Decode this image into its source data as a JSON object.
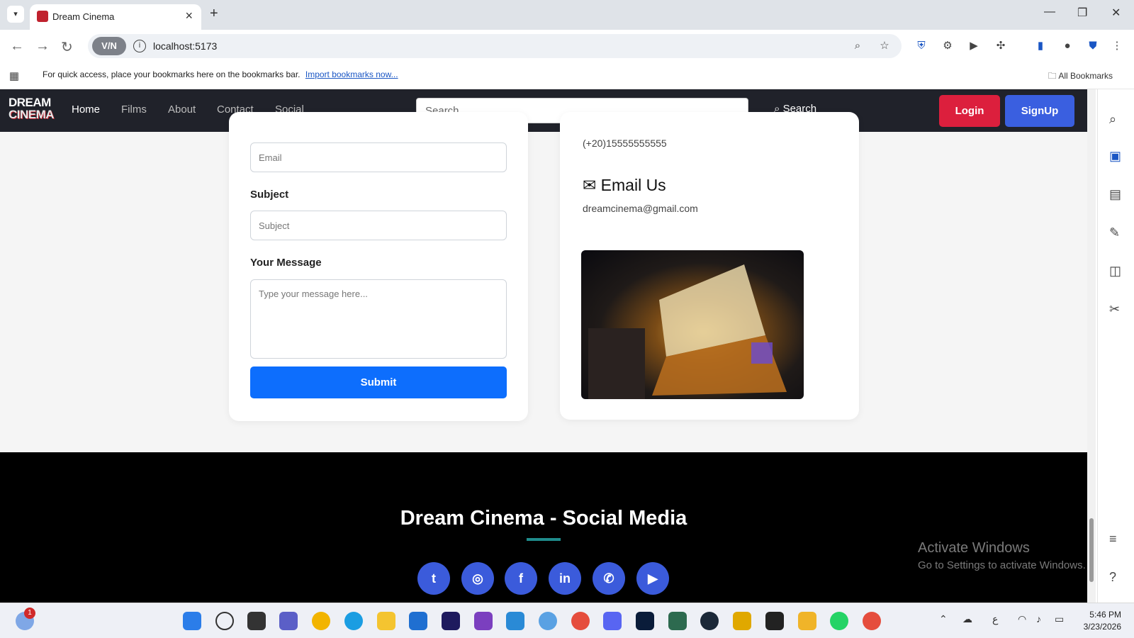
{
  "browser": {
    "tab_title": "Dream Cinema",
    "url": "localhost:5173",
    "vpn_label": "V/N",
    "bookmarks_message": "For quick access, place your bookmarks here on the bookmarks bar.",
    "bookmarks_link": "Import bookmarks now...",
    "all_bookmarks": "All Bookmarks"
  },
  "site": {
    "logo_top": "DREAM",
    "logo_bottom": "CINEMA",
    "nav": [
      "Home",
      "Films",
      "About",
      "Contact",
      "Social"
    ],
    "search_placeholder": "Search...",
    "search_button": "Search",
    "login": "Login",
    "signup": "SignUp"
  },
  "form": {
    "email_placeholder": "Email",
    "subject_label": "Subject",
    "subject_placeholder": "Subject",
    "message_label": "Your Message",
    "message_placeholder": "Type your message here...",
    "submit": "Submit"
  },
  "contact_info": {
    "phone": "(+20)15555555555",
    "email_heading": "Email Us",
    "email": "dreamcinema@gmail.com"
  },
  "footer": {
    "title": "Dream Cinema - Social Media",
    "social": [
      "twitter-icon",
      "instagram-icon",
      "facebook-icon",
      "linkedin-icon",
      "whatsapp-icon",
      "youtube-icon"
    ]
  },
  "os": {
    "activate_title": "Activate Windows",
    "activate_sub": "Go to Settings to activate Windows.",
    "time": "5:46 PM",
    "date": "3/23/2026",
    "notification_count": "1"
  },
  "colors": {
    "nav_bg": "#20222a",
    "login": "#dc1f3d",
    "signup": "#3a5fe0",
    "submit": "#0d6efd",
    "social": "#3b5bdb",
    "footer": "#000000"
  }
}
